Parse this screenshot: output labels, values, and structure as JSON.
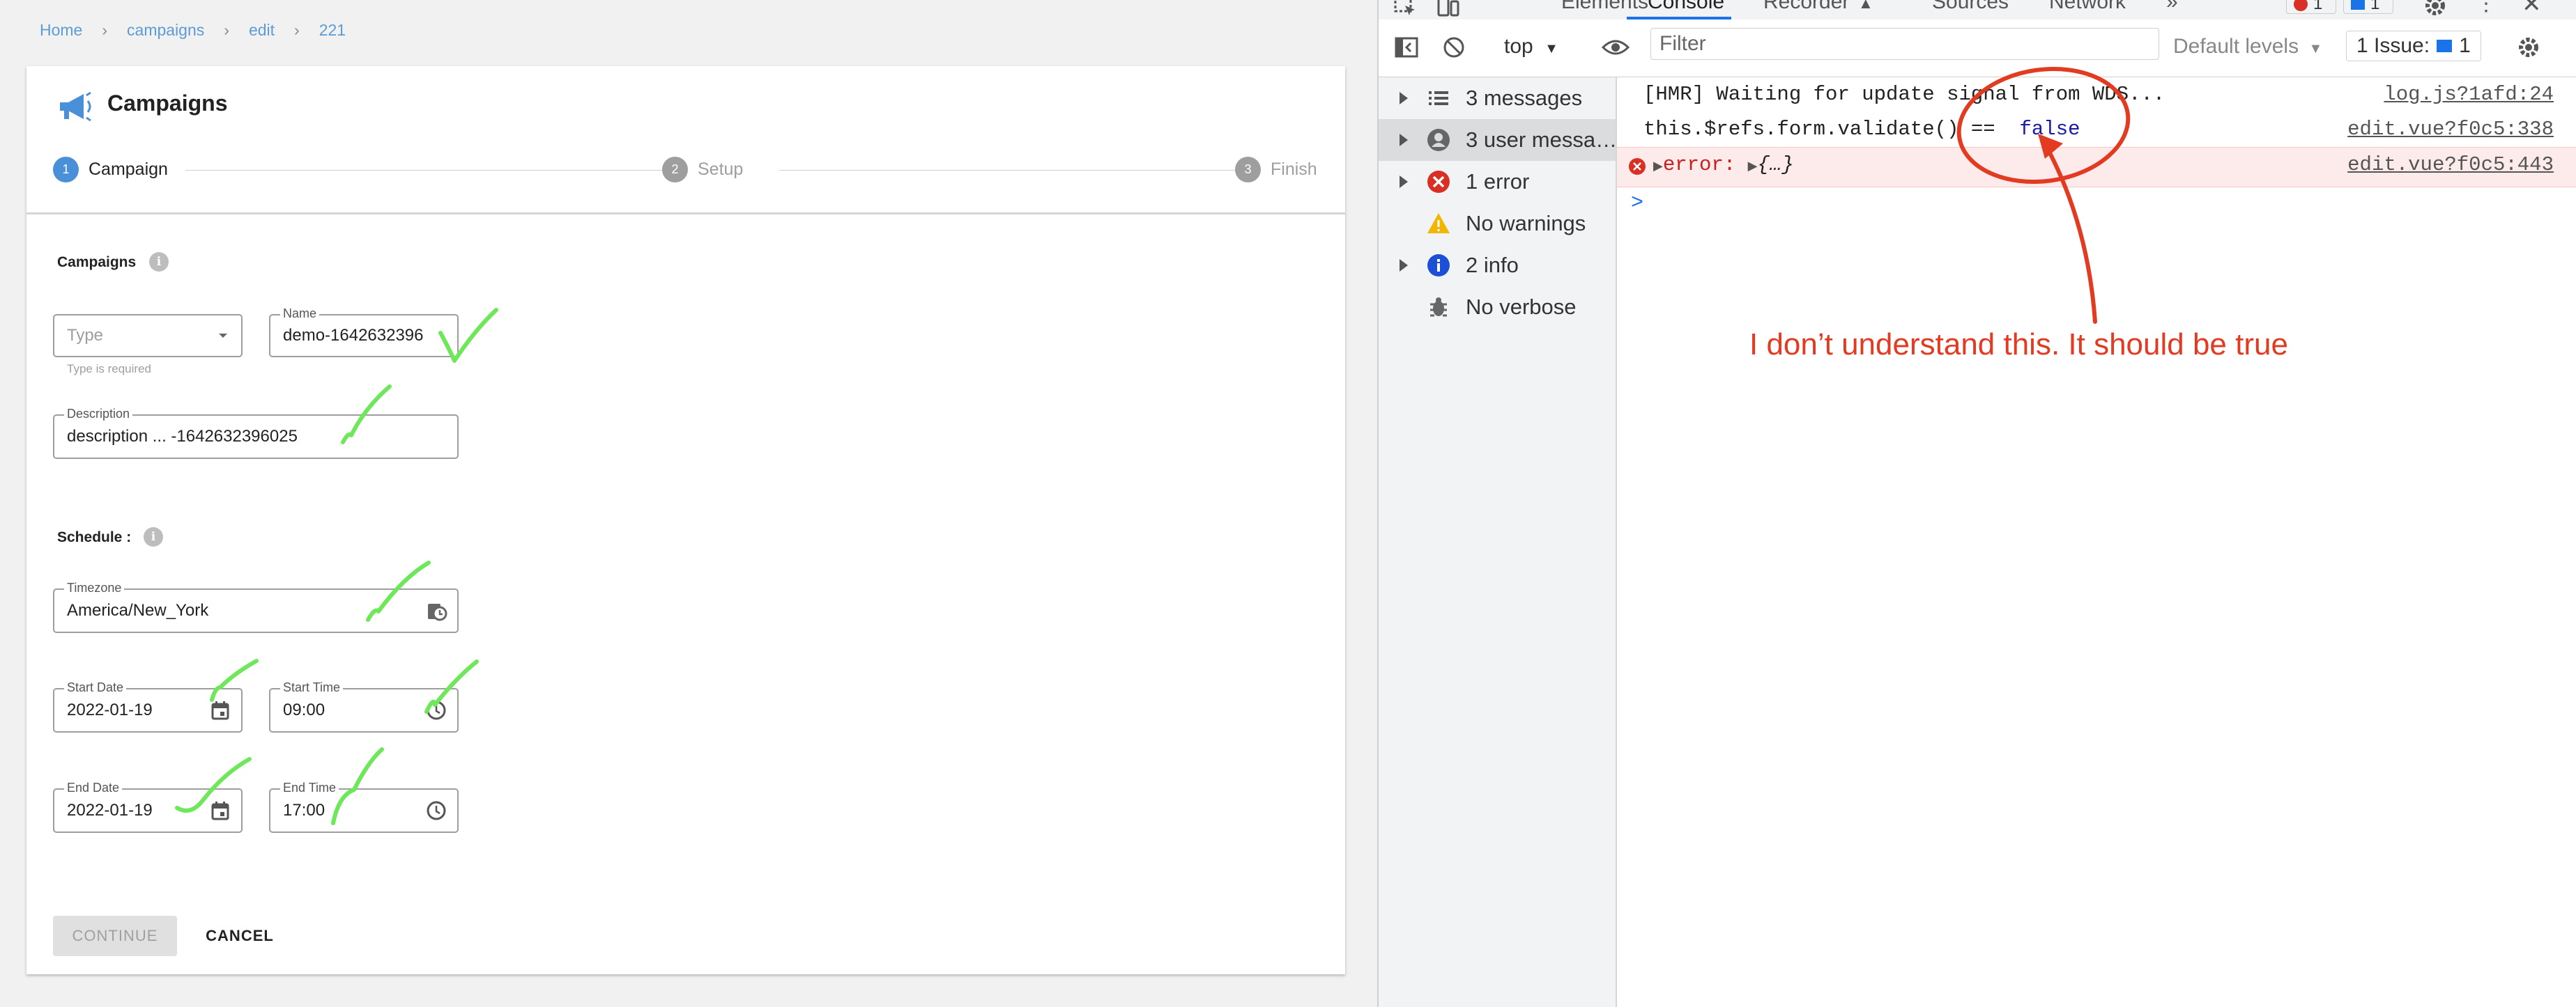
{
  "breadcrumb": [
    "Home",
    "campaigns",
    "edit",
    "221"
  ],
  "card": {
    "title": "Campaigns",
    "steps": [
      {
        "num": "1",
        "label": "Campaign"
      },
      {
        "num": "2",
        "label": "Setup"
      },
      {
        "num": "3",
        "label": "Finish"
      }
    ]
  },
  "form": {
    "section_campaigns": "Campaigns",
    "type": {
      "placeholder": "Type",
      "hint": "Type is required"
    },
    "name": {
      "label": "Name",
      "value": "demo-1642632396"
    },
    "description": {
      "label": "Description",
      "value": "description ... -1642632396025"
    },
    "section_schedule": "Schedule :",
    "timezone": {
      "label": "Timezone",
      "value": "America/New_York"
    },
    "start_date": {
      "label": "Start Date",
      "value": "2022-01-19"
    },
    "start_time": {
      "label": "Start Time",
      "value": "09:00"
    },
    "end_date": {
      "label": "End Date",
      "value": "2022-01-19"
    },
    "end_time": {
      "label": "End Time",
      "value": "17:00"
    },
    "continue": "CONTINUE",
    "cancel": "CANCEL"
  },
  "devtools": {
    "tabs": [
      "Elements",
      "Console",
      "Recorder",
      "Sources",
      "Network",
      "»"
    ],
    "error_badge": "1",
    "message_badge": "1",
    "context": "top",
    "filter_placeholder": "Filter",
    "levels": "Default levels",
    "issues": "1 Issue:",
    "issues_count": "1",
    "sidebar": [
      {
        "label": "3 messages",
        "icon": "list-icon"
      },
      {
        "label": "3 user messa…",
        "icon": "user-icon"
      },
      {
        "label": "1 error",
        "icon": "error-icon"
      },
      {
        "label": "No warnings",
        "icon": "warning-icon"
      },
      {
        "label": "2 info",
        "icon": "info-icon"
      },
      {
        "label": "No verbose",
        "icon": "bug-icon"
      }
    ],
    "logs": [
      {
        "message": "[HMR] Waiting for update signal from WDS...",
        "source": "log.js?1afd:24"
      },
      {
        "message": "this.$refs.form.validate() ==",
        "value": "false",
        "source": "edit.vue?f0c5:338"
      },
      {
        "message": "error:",
        "detail": "{…}",
        "source": "edit.vue?f0c5:443"
      }
    ],
    "prompt": ">"
  },
  "annotation": {
    "text": "I don’t understand this. It should be true",
    "color": "#e23b22",
    "check_color": "#6ee85a"
  }
}
